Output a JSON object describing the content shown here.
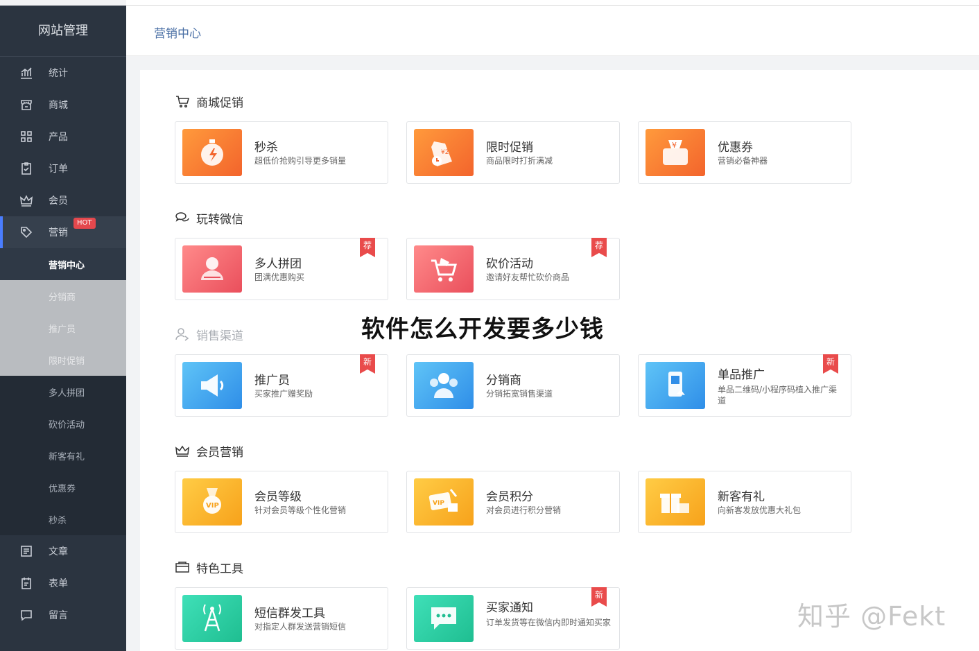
{
  "sidebar": {
    "title": "网站管理",
    "items": [
      {
        "label": "统计",
        "icon": "chart-icon"
      },
      {
        "label": "商城",
        "icon": "store-icon"
      },
      {
        "label": "产品",
        "icon": "grid-icon"
      },
      {
        "label": "订单",
        "icon": "clipboard-icon"
      },
      {
        "label": "会员",
        "icon": "crown-icon"
      },
      {
        "label": "营销",
        "icon": "tag-icon",
        "badge": "HOT"
      }
    ],
    "submenu": [
      "营销中心",
      "分销商",
      "推广员",
      "限时促销",
      "多人拼团",
      "砍价活动",
      "新客有礼",
      "优惠券",
      "秒杀"
    ],
    "items_after": [
      {
        "label": "文章",
        "icon": "article-icon"
      },
      {
        "label": "表单",
        "icon": "form-icon"
      },
      {
        "label": "留言",
        "icon": "message-icon"
      }
    ]
  },
  "header": {
    "title": "营销中心"
  },
  "sections": [
    {
      "title": "商城促销",
      "cards": [
        {
          "name": "秒杀",
          "desc": "超低价抢购引导更多销量"
        },
        {
          "name": "限时促销",
          "desc": "商品限时打折满减"
        },
        {
          "name": "优惠券",
          "desc": "营销必备神器"
        }
      ]
    },
    {
      "title": "玩转微信",
      "cards": [
        {
          "name": "多人拼团",
          "desc": "团满优惠购买",
          "badge": "荐"
        },
        {
          "name": "砍价活动",
          "desc": "邀请好友帮忙砍价商品",
          "badge": "荐"
        }
      ]
    },
    {
      "title": "销售渠道",
      "cards": [
        {
          "name": "推广员",
          "desc": "买家推广赠奖励",
          "badge": "新"
        },
        {
          "name": "分销商",
          "desc": "分销拓宽销售渠道"
        },
        {
          "name": "单品推广",
          "desc": "单品二维码/小程序码植入推广渠道",
          "badge": "新"
        }
      ]
    },
    {
      "title": "会员营销",
      "cards": [
        {
          "name": "会员等级",
          "desc": "针对会员等级个性化营销"
        },
        {
          "name": "会员积分",
          "desc": "对会员进行积分营销"
        },
        {
          "name": "新客有礼",
          "desc": "向新客发放优惠大礼包"
        }
      ]
    },
    {
      "title": "特色工具",
      "cards": [
        {
          "name": "短信群发工具",
          "desc": "对指定人群发送营销短信"
        },
        {
          "name": "买家通知",
          "desc": "订单发货等在微信内即时通知买家",
          "badge": "新"
        }
      ]
    }
  ],
  "overlay": {
    "title": "软件怎么开发要多少钱",
    "watermark": "知乎 @Fekt"
  }
}
